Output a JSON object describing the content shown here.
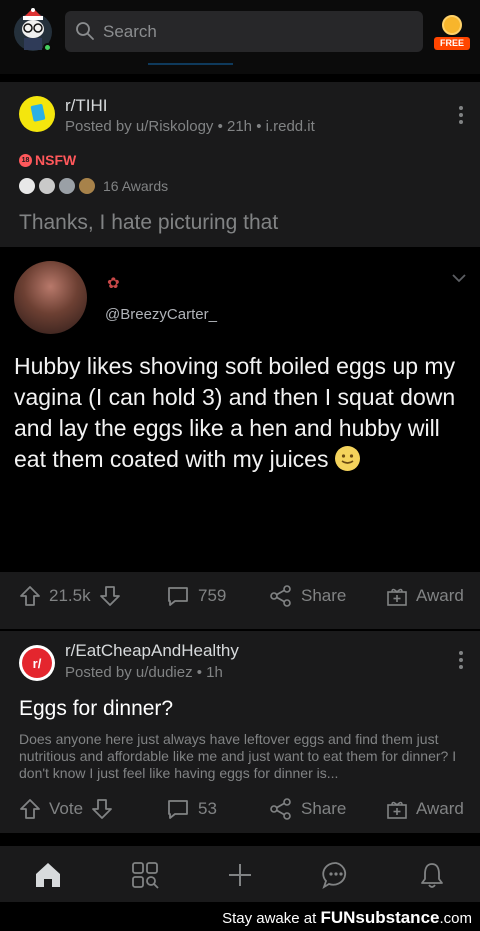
{
  "header": {
    "search_placeholder": "Search",
    "coin_label": "FREE"
  },
  "post1": {
    "subreddit": "r/TIHI",
    "meta": "Posted by u/Riskology • 21h • i.redd.it",
    "nsfw_label": "NSFW",
    "awards_text": "16 Awards",
    "title": "Thanks, I hate picturing that",
    "image": {
      "handle": "@BreezyCarter_",
      "text": "Hubby likes shoving soft boiled eggs up my vagina (I can hold 3) and then I squat down and lay the eggs like a hen and hubby will eat them coated with my juices"
    },
    "votes": "21.5k",
    "comments": "759",
    "share_label": "Share",
    "award_label": "Award"
  },
  "post2": {
    "subreddit": "r/EatCheapAndHealthy",
    "meta": "Posted by u/dudiez • 1h",
    "title": "Eggs for dinner?",
    "body": "Does anyone here just always have leftover eggs and find them just nutritious and affordable like me and just want to eat them for dinner? I don't know I just feel like having eggs for dinner is...",
    "vote_label": "Vote",
    "comments": "53",
    "share_label": "Share",
    "award_label": "Award"
  },
  "nav": {
    "icons": [
      "home-icon",
      "discover-icon",
      "create-icon",
      "chat-icon",
      "notifications-icon"
    ]
  },
  "watermark": {
    "prefix": "Stay awake at ",
    "brand": "FUNsubstance",
    "suffix": ".com"
  },
  "colors": {
    "background": "#000000",
    "card": "#1a1a1b",
    "text_primary": "#d7dadc",
    "text_secondary": "#818384",
    "nsfw": "#ff585b",
    "accent": "#ff4500"
  }
}
